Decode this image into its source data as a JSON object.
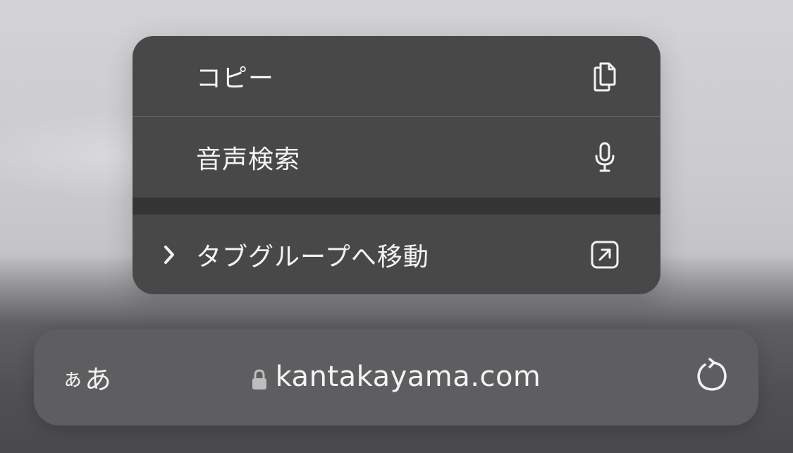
{
  "menu": {
    "items": [
      {
        "label": "コピー",
        "icon": "copy-icon"
      },
      {
        "label": "音声検索",
        "icon": "microphone-icon"
      },
      {
        "label": "タブグループへ移動",
        "icon": "move-out-icon",
        "submenu_icon": "chevron-right-icon"
      }
    ]
  },
  "urlbar": {
    "reader_button": {
      "label_small": "ぁ",
      "label_large": "あ"
    },
    "domain": "kantakayama.com",
    "lock_icon": "lock-icon",
    "reload_icon": "reload-icon"
  },
  "colors": {
    "menu_background": "#484848",
    "urlbar_background": "#5e5e60",
    "text": "#f4f4f4"
  }
}
